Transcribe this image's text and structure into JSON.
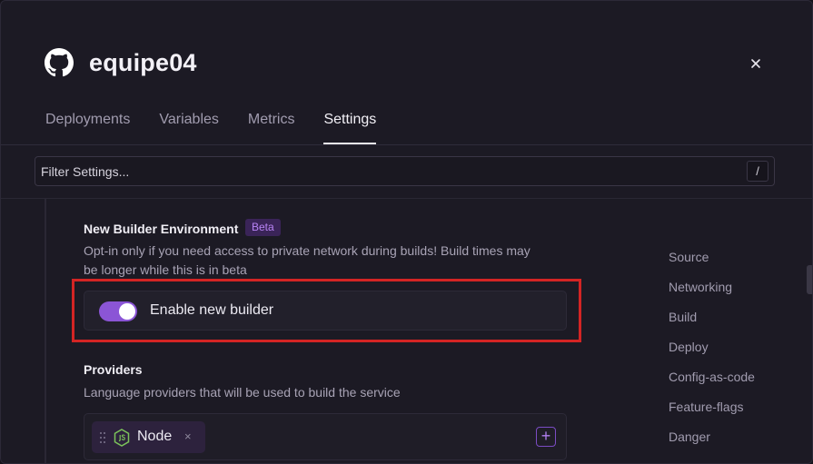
{
  "header": {
    "title": "equipe04",
    "logo_icon": "github-icon",
    "close_icon": "close-icon"
  },
  "tabs": [
    {
      "label": "Deployments",
      "active": false
    },
    {
      "label": "Variables",
      "active": false
    },
    {
      "label": "Metrics",
      "active": false
    },
    {
      "label": "Settings",
      "active": true
    }
  ],
  "filter": {
    "placeholder": "Filter Settings...",
    "shortcut": "/"
  },
  "builder": {
    "title": "New Builder Environment",
    "badge": "Beta",
    "description_line1": "Opt-in only if you need access to private network during builds! Build times may",
    "description_line2": "be longer while this is in beta",
    "toggle_label": "Enable new builder",
    "toggle_on": true
  },
  "providers": {
    "title": "Providers",
    "description": "Language providers that will be used to build the service",
    "items": [
      {
        "label": "Node",
        "icon": "nodejs-icon",
        "remove_symbol": "×"
      }
    ],
    "add_symbol": "+"
  },
  "sidenav": {
    "items": [
      {
        "label": "Source"
      },
      {
        "label": "Networking"
      },
      {
        "label": "Build"
      },
      {
        "label": "Deploy"
      },
      {
        "label": "Config-as-code"
      },
      {
        "label": "Feature-flags"
      },
      {
        "label": "Danger"
      }
    ]
  },
  "colors": {
    "accent": "#8b55d6",
    "badge_bg": "#3a2458",
    "badge_text": "#b883f5",
    "highlight": "#d42424",
    "background": "#1c1a24"
  }
}
